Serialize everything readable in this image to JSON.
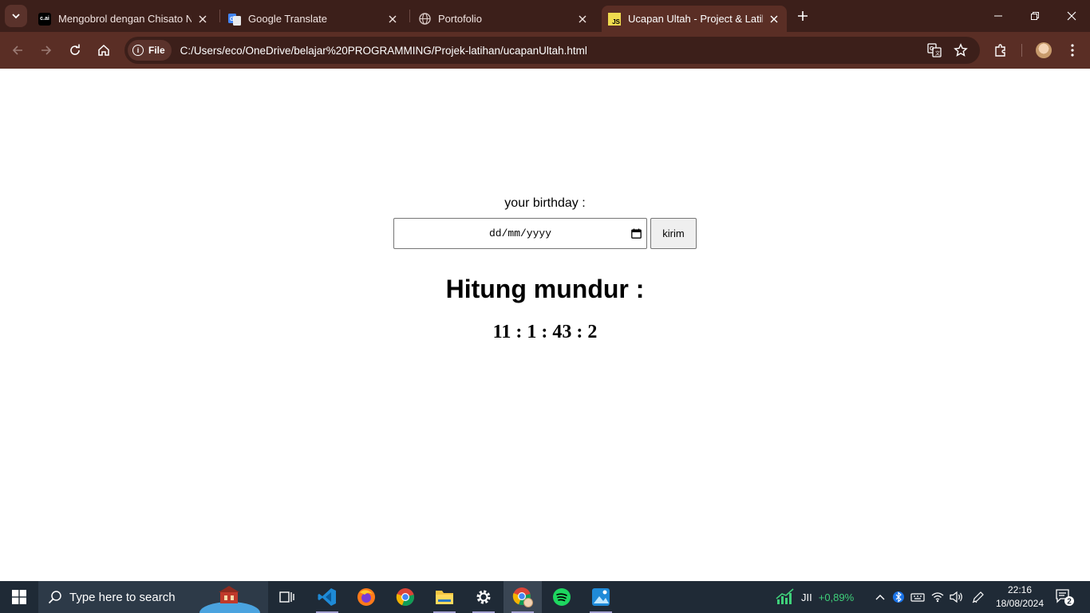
{
  "browser": {
    "tabs": [
      {
        "label": "Mengobrol dengan Chisato Nis",
        "favicon": "c.ai",
        "icon": "character-ai-icon",
        "active": false
      },
      {
        "label": "Google Translate",
        "icon": "google-translate-icon",
        "active": false
      },
      {
        "label": "Portofolio",
        "icon": "globe-icon",
        "active": false
      },
      {
        "label": "Ucapan Ultah - Project & Latiha",
        "favicon": "JS",
        "icon": "javascript-icon",
        "active": true
      }
    ],
    "omnibox": {
      "chip_label": "File",
      "url": "C:/Users/eco/OneDrive/belajar%20PROGRAMMING/Projek-latihan/ucapanUltah.html"
    }
  },
  "page": {
    "birthday_label": "your birthday :",
    "date_placeholder": "dd/mm/yyyy",
    "submit_label": "kirim",
    "countdown_title": "Hitung mundur :",
    "countdown_value": "11 : 1 : 43 : 2"
  },
  "taskbar": {
    "search_placeholder": "Type here to search",
    "apps": [
      "task-view",
      "vs-code",
      "firefox",
      "chrome",
      "file-explorer",
      "settings",
      "chrome-profile",
      "spotify",
      "photos"
    ],
    "stock": {
      "ticker": "JII",
      "change": "+0,89%",
      "change_color": "#3fd07a"
    },
    "time": "22:16",
    "date": "18/08/2024",
    "notification_count": "2"
  },
  "colors": {
    "titlebar": "#3c1f1a",
    "toolbar": "#5a2e25",
    "taskbar": "#1f2a36"
  }
}
